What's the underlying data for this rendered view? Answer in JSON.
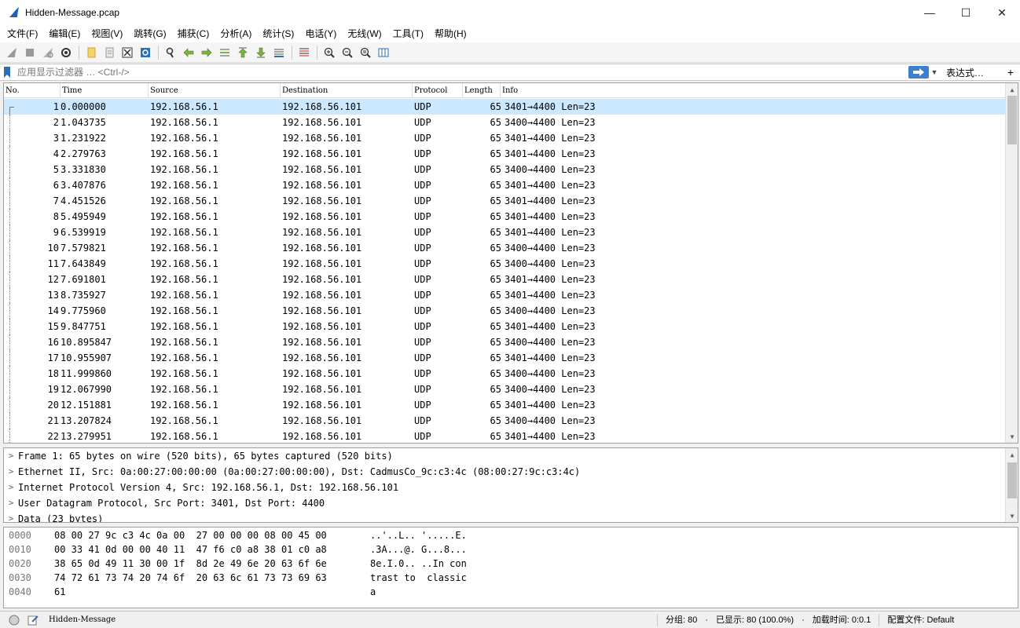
{
  "window": {
    "title": "Hidden-Message.pcap",
    "minimize": "—",
    "maximize": "☐",
    "close": "✕"
  },
  "menu": [
    "文件(F)",
    "编辑(E)",
    "视图(V)",
    "跳转(G)",
    "捕获(C)",
    "分析(A)",
    "统计(S)",
    "电话(Y)",
    "无线(W)",
    "工具(T)",
    "帮助(H)"
  ],
  "filter": {
    "placeholder": "应用显示过滤器 … <Ctrl-/>",
    "expression_label": "表达式…",
    "plus": "+"
  },
  "columns": {
    "no": "No.",
    "time": "Time",
    "source": "Source",
    "destination": "Destination",
    "protocol": "Protocol",
    "length": "Length",
    "info": "Info"
  },
  "packets": [
    {
      "no": "1",
      "time": "0.000000",
      "src": "192.168.56.1",
      "dst": "192.168.56.101",
      "proto": "UDP",
      "len": "65",
      "info": "3401→4400 Len=23"
    },
    {
      "no": "2",
      "time": "1.043735",
      "src": "192.168.56.1",
      "dst": "192.168.56.101",
      "proto": "UDP",
      "len": "65",
      "info": "3400→4400 Len=23"
    },
    {
      "no": "3",
      "time": "1.231922",
      "src": "192.168.56.1",
      "dst": "192.168.56.101",
      "proto": "UDP",
      "len": "65",
      "info": "3401→4400 Len=23"
    },
    {
      "no": "4",
      "time": "2.279763",
      "src": "192.168.56.1",
      "dst": "192.168.56.101",
      "proto": "UDP",
      "len": "65",
      "info": "3401→4400 Len=23"
    },
    {
      "no": "5",
      "time": "3.331830",
      "src": "192.168.56.1",
      "dst": "192.168.56.101",
      "proto": "UDP",
      "len": "65",
      "info": "3400→4400 Len=23"
    },
    {
      "no": "6",
      "time": "3.407876",
      "src": "192.168.56.1",
      "dst": "192.168.56.101",
      "proto": "UDP",
      "len": "65",
      "info": "3401→4400 Len=23"
    },
    {
      "no": "7",
      "time": "4.451526",
      "src": "192.168.56.1",
      "dst": "192.168.56.101",
      "proto": "UDP",
      "len": "65",
      "info": "3401→4400 Len=23"
    },
    {
      "no": "8",
      "time": "5.495949",
      "src": "192.168.56.1",
      "dst": "192.168.56.101",
      "proto": "UDP",
      "len": "65",
      "info": "3401→4400 Len=23"
    },
    {
      "no": "9",
      "time": "6.539919",
      "src": "192.168.56.1",
      "dst": "192.168.56.101",
      "proto": "UDP",
      "len": "65",
      "info": "3401→4400 Len=23"
    },
    {
      "no": "10",
      "time": "7.579821",
      "src": "192.168.56.1",
      "dst": "192.168.56.101",
      "proto": "UDP",
      "len": "65",
      "info": "3400→4400 Len=23"
    },
    {
      "no": "11",
      "time": "7.643849",
      "src": "192.168.56.1",
      "dst": "192.168.56.101",
      "proto": "UDP",
      "len": "65",
      "info": "3400→4400 Len=23"
    },
    {
      "no": "12",
      "time": "7.691801",
      "src": "192.168.56.1",
      "dst": "192.168.56.101",
      "proto": "UDP",
      "len": "65",
      "info": "3401→4400 Len=23"
    },
    {
      "no": "13",
      "time": "8.735927",
      "src": "192.168.56.1",
      "dst": "192.168.56.101",
      "proto": "UDP",
      "len": "65",
      "info": "3401→4400 Len=23"
    },
    {
      "no": "14",
      "time": "9.775960",
      "src": "192.168.56.1",
      "dst": "192.168.56.101",
      "proto": "UDP",
      "len": "65",
      "info": "3400→4400 Len=23"
    },
    {
      "no": "15",
      "time": "9.847751",
      "src": "192.168.56.1",
      "dst": "192.168.56.101",
      "proto": "UDP",
      "len": "65",
      "info": "3401→4400 Len=23"
    },
    {
      "no": "16",
      "time": "10.895847",
      "src": "192.168.56.1",
      "dst": "192.168.56.101",
      "proto": "UDP",
      "len": "65",
      "info": "3400→4400 Len=23"
    },
    {
      "no": "17",
      "time": "10.955907",
      "src": "192.168.56.1",
      "dst": "192.168.56.101",
      "proto": "UDP",
      "len": "65",
      "info": "3401→4400 Len=23"
    },
    {
      "no": "18",
      "time": "11.999860",
      "src": "192.168.56.1",
      "dst": "192.168.56.101",
      "proto": "UDP",
      "len": "65",
      "info": "3400→4400 Len=23"
    },
    {
      "no": "19",
      "time": "12.067990",
      "src": "192.168.56.1",
      "dst": "192.168.56.101",
      "proto": "UDP",
      "len": "65",
      "info": "3400→4400 Len=23"
    },
    {
      "no": "20",
      "time": "12.151881",
      "src": "192.168.56.1",
      "dst": "192.168.56.101",
      "proto": "UDP",
      "len": "65",
      "info": "3401→4400 Len=23"
    },
    {
      "no": "21",
      "time": "13.207824",
      "src": "192.168.56.1",
      "dst": "192.168.56.101",
      "proto": "UDP",
      "len": "65",
      "info": "3400→4400 Len=23"
    },
    {
      "no": "22",
      "time": "13.279951",
      "src": "192.168.56.1",
      "dst": "192.168.56.101",
      "proto": "UDP",
      "len": "65",
      "info": "3401→4400 Len=23"
    }
  ],
  "details": [
    "Frame 1: 65 bytes on wire (520 bits), 65 bytes captured (520 bits)",
    "Ethernet II, Src: 0a:00:27:00:00:00 (0a:00:27:00:00:00), Dst: CadmusCo_9c:c3:4c (08:00:27:9c:c3:4c)",
    "Internet Protocol Version 4, Src: 192.168.56.1, Dst: 192.168.56.101",
    "User Datagram Protocol, Src Port: 3401, Dst Port: 4400",
    "Data (23 bytes)"
  ],
  "bytes": [
    {
      "offset": "0000",
      "hex": "08 00 27 9c c3 4c 0a 00  27 00 00 00 08 00 45 00",
      "ascii": "..'..L.. '.....E."
    },
    {
      "offset": "0010",
      "hex": "00 33 41 0d 00 00 40 11  47 f6 c0 a8 38 01 c0 a8",
      "ascii": ".3A...@. G...8..."
    },
    {
      "offset": "0020",
      "hex": "38 65 0d 49 11 30 00 1f  8d 2e 49 6e 20 63 6f 6e",
      "ascii": "8e.I.0.. ..In con"
    },
    {
      "offset": "0030",
      "hex": "74 72 61 73 74 20 74 6f  20 63 6c 61 73 73 69 63",
      "ascii": "trast to  classic"
    },
    {
      "offset": "0040",
      "hex": "61",
      "ascii": "a"
    }
  ],
  "status": {
    "file": "Hidden-Message",
    "packets": "分组: 80",
    "displayed": "已显示: 80 (100.0%)",
    "load_time": "加载时间: 0:0.1",
    "profile": "配置文件: Default"
  },
  "colors": {
    "selected_row": "#cce8ff",
    "apply_button": "#3c7fd1",
    "fin_blue": "#1f5fbf"
  }
}
